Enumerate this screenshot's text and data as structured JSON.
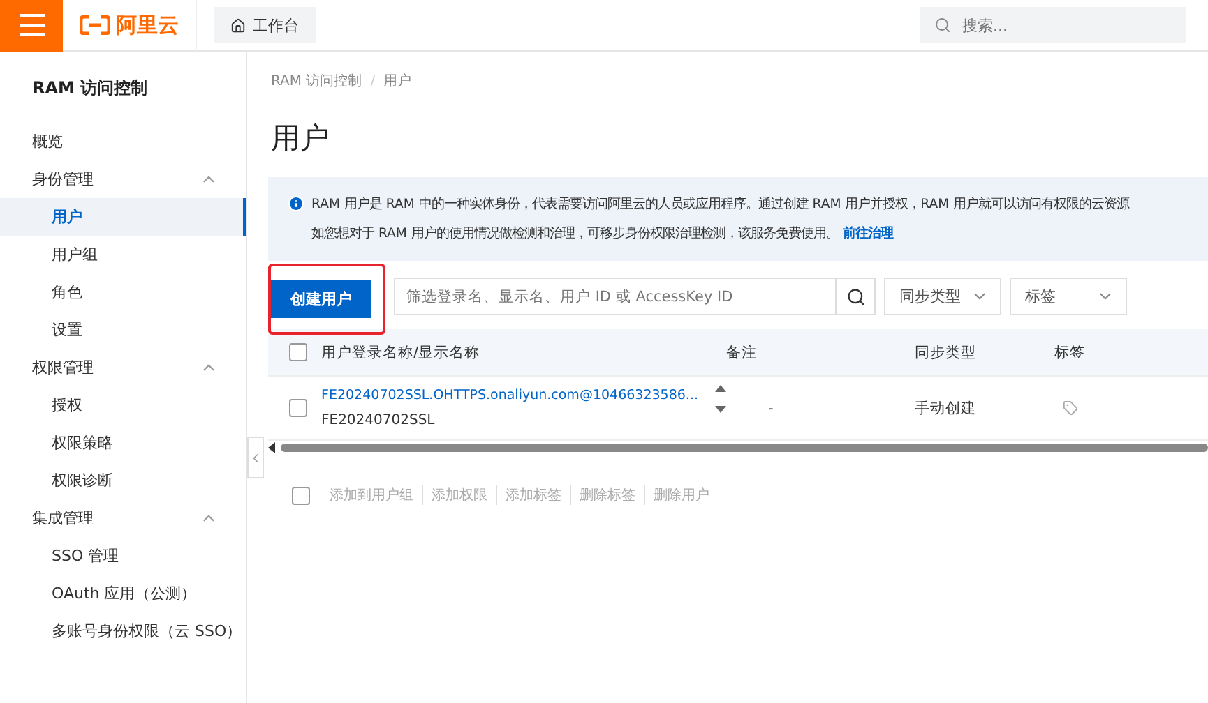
{
  "topbar": {
    "logo": "阿里云",
    "workbench": "工作台",
    "search": {
      "placeholder": "搜索..."
    }
  },
  "sidebar": {
    "title": "RAM 访问控制",
    "items": [
      {
        "label": "概览",
        "selected": false
      },
      {
        "label": "身份管理",
        "expanded": true,
        "children": [
          {
            "label": "用户",
            "selected": true
          },
          {
            "label": "用户组",
            "selected": false
          },
          {
            "label": "角色",
            "selected": false
          },
          {
            "label": "设置",
            "selected": false
          }
        ]
      },
      {
        "label": "权限管理",
        "expanded": true,
        "children": [
          {
            "label": "授权",
            "selected": false
          },
          {
            "label": "权限策略",
            "selected": false
          },
          {
            "label": "权限诊断",
            "selected": false
          }
        ]
      },
      {
        "label": "集成管理",
        "expanded": true,
        "children": [
          {
            "label": "SSO 管理",
            "selected": false
          },
          {
            "label": "OAuth 应用（公测）",
            "selected": false
          },
          {
            "label": "多账号身份权限（云 SSO）",
            "selected": false
          }
        ]
      }
    ]
  },
  "breadcrumb": [
    "RAM 访问控制",
    "/",
    "用户"
  ],
  "page_title": "用户",
  "notice": {
    "line_1": "RAM 用户是 RAM 中的一种实体身份，代表需要访问阿里云的人员或应用程序。通过创建 RAM 用户并授权，RAM 用户就可以访问有权限的云资源",
    "line_2": "如您想对于 RAM 用户的使用情况做检测和治理，可移步身份权限治理检测，该服务免费使用。",
    "link": "前往治理"
  },
  "toolbar": {
    "create_button": {
      "label": "创建用户",
      "highlighted": true
    },
    "filter": {
      "placeholder": "筛选登录名、显示名、用户 ID 或 AccessKey ID"
    },
    "dropdowns": [
      "同步类型",
      "标签"
    ]
  },
  "table": {
    "select_all_checked": false,
    "columns": [
      "用户登录名称/显示名称",
      "备注",
      "同步类型",
      "标签"
    ],
    "rows": [
      {
        "checked": false,
        "login_name": "FE20240702SSL.OHTTPS.onaliyun.com@10466323586...",
        "display_name": "FE20240702SSL",
        "note": "-",
        "sync_type": "手动创建"
      }
    ]
  },
  "batch_select_checked": false,
  "batch_actions": [
    {
      "label": "添加到用户组",
      "disabled": true
    },
    {
      "label": "添加权限",
      "disabled": true
    },
    {
      "label": "添加标签",
      "disabled": true
    },
    {
      "label": "删除标签",
      "disabled": true
    },
    {
      "label": "删除用户",
      "disabled": true
    }
  ]
}
